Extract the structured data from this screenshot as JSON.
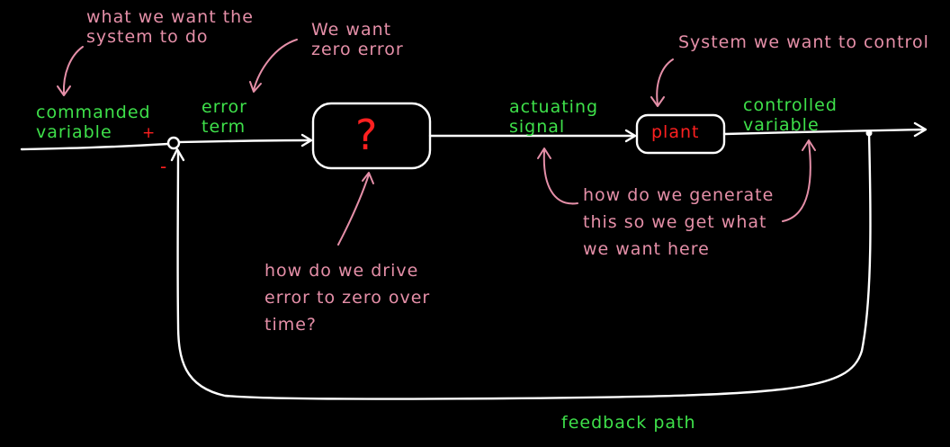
{
  "colors": {
    "background": "#000000",
    "line": "#ffffff",
    "green": "#3ee04a",
    "pink": "#e58fa8",
    "red": "#ff2020"
  },
  "labels": {
    "commanded_line1": "commanded",
    "commanded_line2": "variable",
    "plus_sign": "+",
    "minus_sign": "-",
    "error_line1": "error",
    "error_line2": "term",
    "question_mark": "?",
    "actuating_line1": "actuating",
    "actuating_line2": "signal",
    "plant": "plant",
    "controlled_line1": "controlled",
    "controlled_line2": "variable",
    "feedback": "feedback path"
  },
  "notes": {
    "want_line1": "what we want the",
    "want_line2": "system to do",
    "zero_line1": "We want",
    "zero_line2": "zero error",
    "control_line1": "System we want to control",
    "drive_line1": "how do we drive",
    "drive_line2": "error to zero over",
    "drive_line3": "time?",
    "generate_line1": "how do we generate",
    "generate_line2": "this so we get what",
    "generate_line3": "we want here"
  }
}
